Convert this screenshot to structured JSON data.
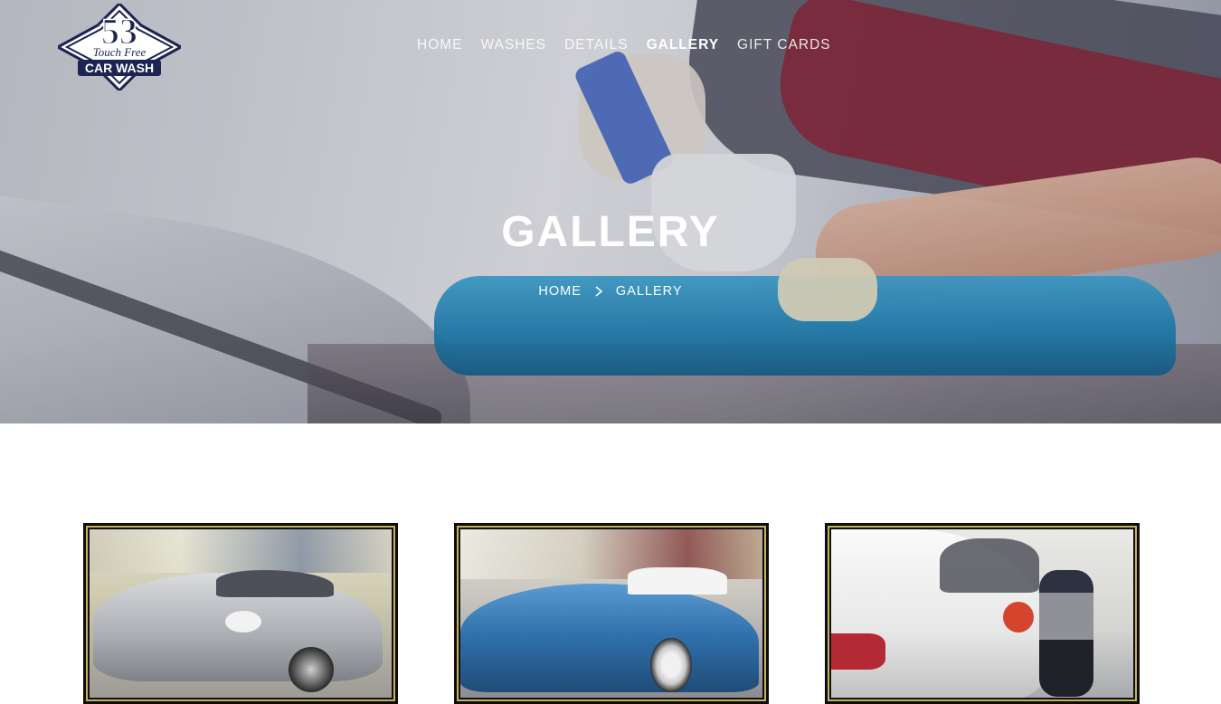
{
  "brand": {
    "number": "53",
    "tagline": "Touch Free",
    "name": "CAR WASH"
  },
  "nav": {
    "items": [
      "HOME",
      "WASHES",
      "DETAILS",
      "GALLERY",
      "GIFT CARDS"
    ],
    "active": "GALLERY"
  },
  "hero": {
    "title": "GALLERY",
    "breadcrumb": [
      "HOME",
      "GALLERY"
    ]
  },
  "gallery": {
    "frame_color": "#c7b15a",
    "items": [
      {
        "subject": "silver-convertible"
      },
      {
        "subject": "blue-classic-corvette"
      },
      {
        "subject": "white-sedan-polishing"
      }
    ]
  }
}
